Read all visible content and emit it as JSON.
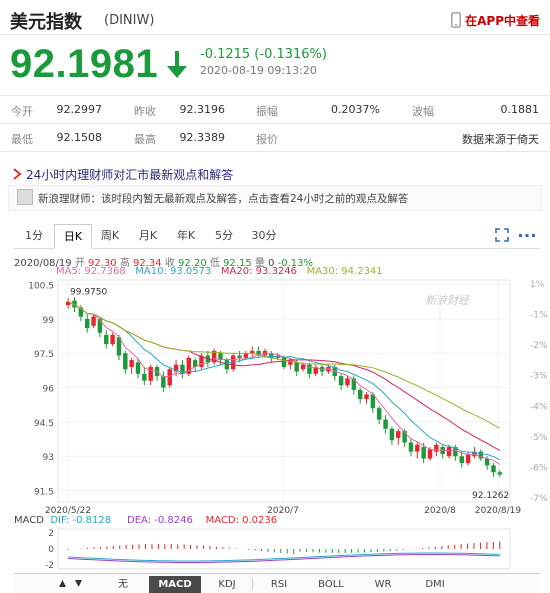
{
  "header": {
    "title": "美元指数",
    "code": "(DINIW)",
    "app_link": "在APP中查看"
  },
  "quote": {
    "price": "92.1981",
    "change": "-0.1215 (-0.1316%)",
    "timestamp": "2020-08-19 09:13:20",
    "color": "#1a9a3a"
  },
  "stats": [
    [
      {
        "label": "今开",
        "value": "92.2997"
      },
      {
        "label": "昨收",
        "value": "92.3196"
      },
      {
        "label": "振幅",
        "value": "0.2037%"
      },
      {
        "label": "波幅",
        "value": "0.1881"
      }
    ],
    [
      {
        "label": "最低",
        "value": "92.1508"
      },
      {
        "label": "最高",
        "value": "92.3389"
      },
      {
        "label": "报价",
        "value": "数据来源于倚天"
      }
    ]
  ],
  "advisor": {
    "title": "24小时内理财师对汇市最新观点和解答",
    "message": "新浪理财师：该时段内暂无最新观点及解答，点击查看24小时之前的观点及解答"
  },
  "tabs": [
    "1分",
    "日K",
    "周K",
    "月K",
    "年K",
    "5分",
    "30分"
  ],
  "active_tab": "日K",
  "ohlc": {
    "date": "2020/08/19",
    "open_label": "开",
    "open": "92.30",
    "high_label": "高",
    "high": "92.34",
    "close_label": "收",
    "close": "92.20",
    "low_label": "低",
    "low": "92.15",
    "volume_label": "量",
    "volume": "0",
    "change": "-0.13%"
  },
  "ma": {
    "ma5": "MA5: 92.7368",
    "ma10": "MA10: 93.0573",
    "ma20": "MA20: 93.3246",
    "ma30": "MA30: 94.2341"
  },
  "watermark": "新浪财经",
  "chart_data": {
    "type": "candlestick",
    "y_ticks": [
      "100.5",
      "99",
      "97.5",
      "96",
      "94.5",
      "93",
      "91.5"
    ],
    "pct_ticks": [
      "1%",
      "-1%",
      "-2%",
      "-3%",
      "-4%",
      "-5%",
      "-6%",
      "-7%"
    ],
    "x_ticks": [
      "2020/5/22",
      "2020/7",
      "2020/8",
      "2020/8/19"
    ],
    "ylim": [
      91.0,
      100.7
    ],
    "max_label": "99.9750",
    "min_label": "92.1262",
    "candles": [
      [
        99.6,
        99.75,
        99.45,
        99.9
      ],
      [
        99.8,
        99.5,
        99.3,
        99.95
      ],
      [
        99.5,
        99.1,
        98.9,
        99.6
      ],
      [
        99.0,
        98.6,
        98.4,
        99.2
      ],
      [
        98.7,
        99.1,
        98.6,
        99.2
      ],
      [
        99.0,
        98.4,
        98.2,
        99.1
      ],
      [
        98.3,
        97.9,
        97.7,
        98.5
      ],
      [
        97.9,
        98.3,
        97.8,
        98.4
      ],
      [
        98.2,
        97.4,
        97.2,
        98.3
      ],
      [
        97.5,
        96.8,
        96.6,
        97.6
      ],
      [
        96.9,
        97.2,
        96.6,
        97.3
      ],
      [
        97.1,
        96.6,
        96.4,
        97.3
      ],
      [
        96.6,
        96.3,
        96.1,
        96.9
      ],
      [
        96.3,
        96.9,
        96.1,
        97.0
      ],
      [
        96.9,
        96.5,
        96.3,
        97.0
      ],
      [
        96.5,
        96.0,
        95.8,
        96.7
      ],
      [
        96.1,
        96.8,
        96.0,
        96.9
      ],
      [
        96.7,
        97.0,
        96.5,
        97.2
      ],
      [
        97.0,
        96.6,
        96.4,
        97.2
      ],
      [
        96.6,
        97.3,
        96.5,
        97.4
      ],
      [
        97.2,
        96.9,
        96.7,
        97.3
      ],
      [
        96.9,
        97.4,
        96.8,
        97.5
      ],
      [
        97.4,
        97.1,
        96.9,
        97.6
      ],
      [
        97.1,
        97.6,
        97.0,
        97.7
      ],
      [
        97.5,
        97.2,
        97.0,
        97.6
      ],
      [
        97.2,
        96.8,
        96.6,
        97.3
      ],
      [
        96.8,
        97.4,
        96.7,
        97.5
      ],
      [
        97.4,
        97.3,
        97.1,
        97.6
      ],
      [
        97.3,
        97.5,
        97.2,
        97.6
      ],
      [
        97.5,
        97.6,
        97.3,
        97.8
      ],
      [
        97.6,
        97.4,
        97.3,
        97.8
      ],
      [
        97.4,
        97.6,
        97.3,
        97.7
      ],
      [
        97.5,
        97.3,
        97.1,
        97.6
      ],
      [
        97.3,
        97.4,
        97.2,
        97.5
      ],
      [
        97.3,
        96.9,
        96.8,
        97.4
      ],
      [
        97.0,
        97.2,
        96.8,
        97.3
      ],
      [
        97.1,
        96.7,
        96.5,
        97.2
      ],
      [
        96.8,
        97.0,
        96.7,
        97.1
      ],
      [
        97.0,
        96.6,
        96.4,
        97.1
      ],
      [
        96.6,
        96.9,
        96.5,
        97.0
      ],
      [
        96.9,
        96.7,
        96.5,
        97.0
      ],
      [
        96.7,
        96.9,
        96.6,
        97.0
      ],
      [
        96.9,
        96.5,
        96.3,
        97.0
      ],
      [
        96.5,
        96.1,
        95.9,
        96.6
      ],
      [
        96.1,
        96.4,
        96.0,
        96.5
      ],
      [
        96.4,
        95.9,
        95.7,
        96.5
      ],
      [
        95.9,
        95.5,
        95.3,
        96.0
      ],
      [
        95.5,
        95.7,
        95.3,
        95.8
      ],
      [
        95.7,
        95.1,
        94.9,
        95.8
      ],
      [
        95.1,
        94.6,
        94.4,
        95.2
      ],
      [
        94.6,
        94.2,
        94.0,
        94.8
      ],
      [
        94.2,
        93.7,
        93.5,
        94.3
      ],
      [
        93.8,
        94.1,
        93.5,
        94.2
      ],
      [
        94.1,
        93.6,
        93.4,
        94.2
      ],
      [
        93.6,
        93.2,
        93.0,
        93.8
      ],
      [
        93.2,
        93.5,
        92.9,
        93.6
      ],
      [
        93.4,
        92.9,
        92.7,
        93.6
      ],
      [
        92.9,
        93.3,
        92.8,
        93.4
      ],
      [
        93.2,
        93.5,
        93.0,
        93.6
      ],
      [
        93.4,
        93.1,
        92.9,
        93.5
      ],
      [
        93.0,
        93.4,
        92.9,
        93.5
      ],
      [
        93.4,
        93.0,
        92.8,
        93.5
      ],
      [
        93.0,
        92.7,
        92.5,
        93.2
      ],
      [
        92.7,
        93.1,
        92.6,
        93.2
      ],
      [
        93.0,
        93.2,
        92.9,
        93.4
      ],
      [
        93.2,
        92.9,
        92.8,
        93.3
      ],
      [
        92.9,
        92.6,
        92.4,
        93.0
      ],
      [
        92.6,
        92.3,
        92.1,
        92.7
      ],
      [
        92.3,
        92.2,
        92.1,
        92.4
      ]
    ]
  },
  "macd": {
    "label": "MACD",
    "dif": "DIF: -0.8128",
    "dea": "DEA: -0.8246",
    "macd": "MACD: 0.0236",
    "y_ticks": [
      "2",
      "0",
      "-2"
    ]
  },
  "indicator_tabs": [
    "无",
    "MACD",
    "KDJ",
    "RSI",
    "BOLL",
    "WR",
    "DMI"
  ],
  "active_indicator": "MACD",
  "colors": {
    "up": "#e8262d",
    "down": "#1a9a3a",
    "accent": "#c00"
  }
}
